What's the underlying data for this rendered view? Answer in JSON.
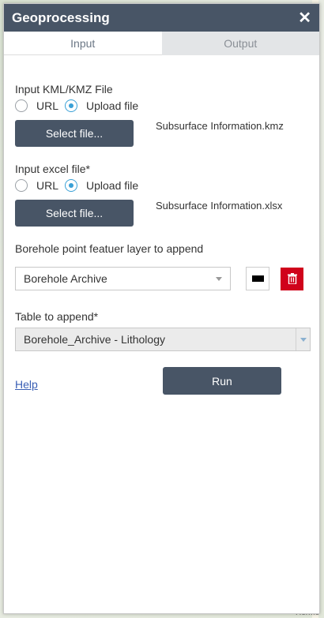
{
  "panel": {
    "title": "Geoprocessing",
    "close_glyph": "✕"
  },
  "tabs": [
    {
      "label": "Input",
      "active": true
    },
    {
      "label": "Output",
      "active": false
    }
  ],
  "kml": {
    "label": "Input KML/KMZ File",
    "radio_url": "URL",
    "radio_upload": "Upload file",
    "selected": "Upload file",
    "button": "Select file...",
    "filename": "Subsurface Information.kmz"
  },
  "excel": {
    "label": "Input excel file*",
    "radio_url": "URL",
    "radio_upload": "Upload file",
    "selected": "Upload file",
    "button": "Select file...",
    "filename": "Subsurface Information.xlsx"
  },
  "layer": {
    "label": "Borehole point featuer layer to append",
    "value": "Borehole Archive",
    "symbol_color": "#000000",
    "delete_color": "#d0021b"
  },
  "table": {
    "label": "Table to append*",
    "value": "Borehole_Archive - Lithology"
  },
  "footer": {
    "help": "Help",
    "run": "Run"
  },
  "map": {
    "label_bottom": "Hermo"
  }
}
